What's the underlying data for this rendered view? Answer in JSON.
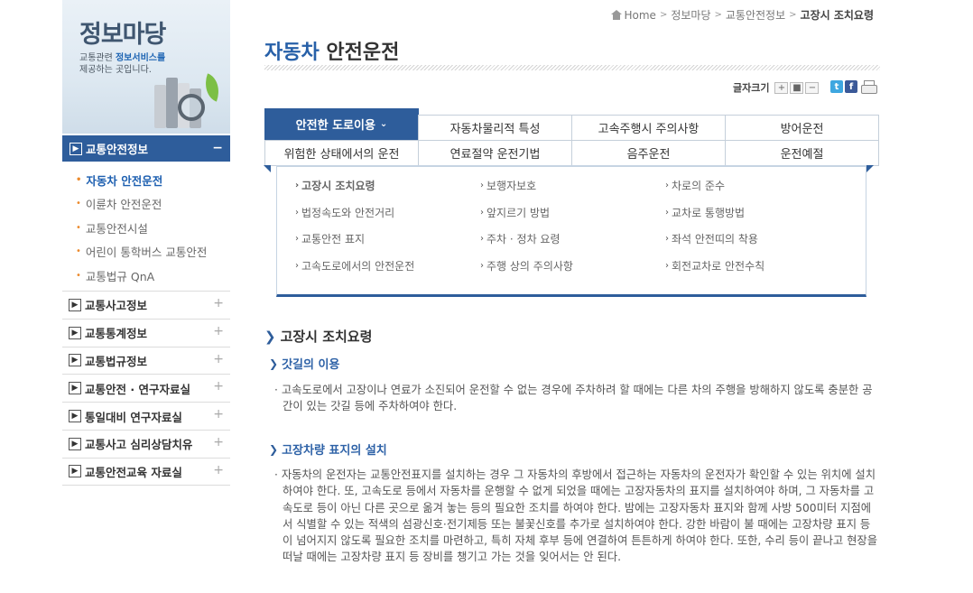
{
  "sidebar": {
    "banner_title": "정보마당",
    "banner_sub_pre": "교통관련 ",
    "banner_sub_highlight": "정보서비스를",
    "banner_sub_post": "제공하는 곳입니다.",
    "active_menu": "교통안전정보",
    "submenu": [
      "자동차 안전운전",
      "이륜차 안전운전",
      "교통안전시설",
      "어린이 통학버스 교통안전",
      "교통법규 QnA"
    ],
    "menu": [
      "교통사고정보",
      "교통통계정보",
      "교통법규정보",
      "교통안전 · 연구자료실",
      "통일대비 연구자료실",
      "교통사고 심리상담치유",
      "교통안전교육 자료실"
    ]
  },
  "breadcrumb": [
    "Home",
    "정보마당",
    "교통안전정보",
    "고장시 조치요령"
  ],
  "page_title": {
    "strong": "자동차",
    "rest": " 안전운전"
  },
  "tools": {
    "font_size_label": "글자크기",
    "plus": "+",
    "reset": "■",
    "minus": "−",
    "twitter": "t",
    "facebook": "f"
  },
  "tabs": [
    "안전한 도로이용",
    "자동차물리적 특성",
    "고속주행시 주의사항",
    "방어운전",
    "위험한 상태에서의 운전",
    "연료절약 운전기법",
    "음주운전",
    "운전예절"
  ],
  "panel_links": [
    "고장시 조치요령",
    "보행자보호",
    "차로의 준수",
    "법정속도와 안전거리",
    "앞지르기 방법",
    "교차로 통행방법",
    "교통안전 표지",
    "주차 · 정차 요령",
    "좌석 안전띠의 착용",
    "고속도로에서의 안전운전",
    "주행 상의 주의사항",
    "회전교차로 안전수칙"
  ],
  "content": {
    "section_title": "고장시 조치요령",
    "sub1_title": "갓길의 이용",
    "sub1_text": "· 고속도로에서 고장이나 연료가 소진되어 운전할 수 없는 경우에 주차하려 할 때에는 다른 차의 주행을 방해하지 않도록 충분한 공간이 있는 갓길 등에 주차하여야 한다.",
    "sub2_title": "고장차량 표지의 설치",
    "sub2_text": "· 자동차의 운전자는 교통안전표지를 설치하는 경우 그 자동차의 후방에서 접근하는 자동차의 운전자가 확인할 수 있는 위치에 설치하여야 한다. 또, 고속도로 등에서 자동차를 운행할 수 없게 되었을 때에는 고장자동차의 표지를 설치하여야 하며, 그 자동차를 고속도로 등이 아닌 다른 곳으로 옮겨 놓는 등의 필요한 조치를 하여야 한다. 밤에는 고장자동차 표지와 함께 사방 500미터 지점에서 식별할 수 있는 적색의 섬광신호·전기제등 또는 불꽃신호를 추가로 설치하여야 한다. 강한 바람이 불 때에는 고장차량 표지 등이 넘어지지 않도록 필요한 조치를 마련하고, 특히 자체 후부 등에 연결하여 튼튼하게 하여야 한다. 또한, 수리 등이 끝나고 현장을 떠날 때에는 고장차량 표지 등 장비를 챙기고 가는 것을 잊어서는 안 된다."
  }
}
